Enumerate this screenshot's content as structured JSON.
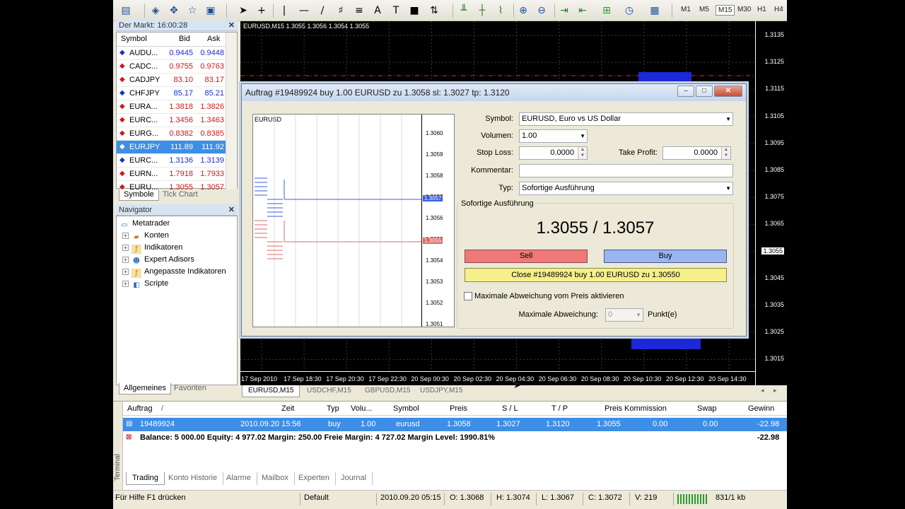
{
  "toolbar": {
    "timeframes": [
      "M1",
      "M5",
      "M15",
      "M30",
      "H1",
      "H4"
    ],
    "active_timeframe": "M15"
  },
  "market_watch": {
    "title": "Der Markt: 16:00:28",
    "col_symbol": "Symbol",
    "col_bid": "Bid",
    "col_ask": "Ask",
    "rows": [
      {
        "symbol": "AUDU...",
        "bid": "0.9445",
        "ask": "0.9448",
        "dir": "up"
      },
      {
        "symbol": "CADC...",
        "bid": "0.9755",
        "ask": "0.9763",
        "dir": "down"
      },
      {
        "symbol": "CADJPY",
        "bid": "83.10",
        "ask": "83.17",
        "dir": "down"
      },
      {
        "symbol": "CHFJPY",
        "bid": "85.17",
        "ask": "85.21",
        "dir": "up"
      },
      {
        "symbol": "EURA...",
        "bid": "1.3818",
        "ask": "1.3826",
        "dir": "down"
      },
      {
        "symbol": "EURC...",
        "bid": "1.3456",
        "ask": "1.3463",
        "dir": "down"
      },
      {
        "symbol": "EURG...",
        "bid": "0.8382",
        "ask": "0.8385",
        "dir": "down"
      },
      {
        "symbol": "EURJPY",
        "bid": "111.89",
        "ask": "111.92",
        "dir": "down",
        "selected": true
      },
      {
        "symbol": "EURC...",
        "bid": "1.3136",
        "ask": "1.3139",
        "dir": "up"
      },
      {
        "symbol": "EURN...",
        "bid": "1.7918",
        "ask": "1.7933",
        "dir": "down"
      },
      {
        "symbol": "EURU...",
        "bid": "1.3055",
        "ask": "1.3057",
        "dir": "down"
      }
    ],
    "tabs": [
      "Symbole",
      "Tick Chart"
    ]
  },
  "navigator": {
    "title": "Navigator",
    "items": [
      "Metatrader",
      "Konten",
      "Indikatoren",
      "Expert Adisors",
      "Angepasste Indikatoren",
      "Scripte"
    ],
    "tabs": [
      "Allgemeines",
      "Favoriten"
    ]
  },
  "chart": {
    "label": "EURUSD,M15  1.3055 1.3056 1.3054 1.3055",
    "price_ticks": [
      "1.3135",
      "1.3125",
      "1.3115",
      "1.3105",
      "1.3095",
      "1.3085",
      "1.3075",
      "1.3065",
      "1.3055",
      "1.3045",
      "1.3035",
      "1.3025",
      "1.3015"
    ],
    "current_price": "1.3055",
    "time_ticks": [
      "17 Sep 2010",
      "17 Sep 18:30",
      "17 Sep 20:30",
      "17 Sep 22:30",
      "20 Sep 00:30",
      "20 Sep 02:30",
      "20 Sep 04:30",
      "20 Sep 06:30",
      "20 Sep 08:30",
      "20 Sep 10:30",
      "20 Sep 12:30",
      "20 Sep 14:30"
    ],
    "tabs": [
      "EURUSD,M15",
      "USDCHF,M15",
      "GBPUSD,M15",
      "USDJPY,M15"
    ],
    "colors": {
      "bull": "#1d28d8",
      "line": "#ff2020"
    }
  },
  "order_dialog": {
    "title": "Auftrag #19489924 buy 1.00 EURUSD zu 1.3058 sl: 1.3027 tp: 1.3120",
    "mini_chart": {
      "symbol": "EURUSD",
      "ticks": [
        "1.3060",
        "1.3059",
        "1.3058",
        "1.3057",
        "1.3056",
        "1.3055",
        "1.3054",
        "1.3053",
        "1.3052",
        "1.3051"
      ],
      "ask_tag": "1.3057",
      "bid_tag": "1.3055"
    },
    "symbol_label": "Symbol:",
    "symbol_value": "EURUSD, Euro vs US Dollar",
    "volume_label": "Volumen:",
    "volume_value": "1.00",
    "stoploss_label": "Stop Loss:",
    "stoploss_value": "0.0000",
    "takeprofit_label": "Take Profit:",
    "takeprofit_value": "0.0000",
    "comment_label": "Kommentar:",
    "comment_value": "",
    "type_label": "Typ:",
    "type_value": "Sofortige Ausführung",
    "section_label": "Sofortige Ausführung",
    "quote": "1.3055 / 1.3057",
    "sell_label": "Sell",
    "buy_label": "Buy",
    "close_label": "Close #19489924 buy 1.00 EURUSD zu 1.30550",
    "max_dev_check_label": "Maximale Abweichung vom Preis aktivieren",
    "max_dev_label": "Maximale Abweichung:",
    "max_dev_value": "0",
    "max_dev_unit": "Punkt(e)"
  },
  "terminal": {
    "side_label": "Terminal",
    "headers": [
      "Auftrag",
      "/",
      "Zeit",
      "Typ",
      "Volu...",
      "Symbol",
      "Preis",
      "S / L",
      "T / P",
      "Preis",
      "Kommission",
      "Swap",
      "Gewinn"
    ],
    "order": {
      "ticket": "19489924",
      "time": "2010.09.20 15:56",
      "type": "buy",
      "volume": "1.00",
      "symbol": "eurusd",
      "price": "1.3058",
      "sl": "1.3027",
      "tp": "1.3120",
      "cur_price": "1.3055",
      "commission": "0.00",
      "swap": "0.00",
      "profit": "-22.98"
    },
    "balance_line": "Balance: 5 000.00  Equity: 4 977.02  Margin: 250.00  Freie Margin: 4 727.02  Margin Level: 1990.81%",
    "balance_profit": "-22.98",
    "tabs": [
      "Trading",
      "Konto Historie",
      "Alarme",
      "Mailbox",
      "Experten",
      "Journal"
    ]
  },
  "status": {
    "help": "Für Hilfe F1 drücken",
    "profile": "Default",
    "datetime": "2010.09.20 05:15",
    "open": "O: 1.3068",
    "high": "H: 1.3074",
    "low": "L: 1.3067",
    "close": "C: 1.3072",
    "volume": "V: 219",
    "traffic": "831/1 kb"
  }
}
